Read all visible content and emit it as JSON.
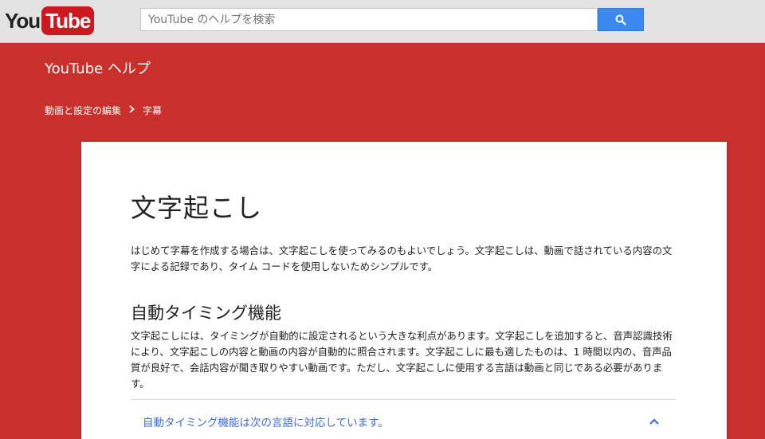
{
  "header": {
    "logo_you": "You",
    "logo_tube": "Tube",
    "search_placeholder": "YouTube のヘルプを検索",
    "search_icon": "search-icon"
  },
  "hero": {
    "help_title": "YouTube ヘルプ",
    "breadcrumb": [
      {
        "label": "動画と設定の編集"
      },
      {
        "label": "字幕"
      }
    ],
    "breadcrumb_separator_icon": "chevron-right-icon"
  },
  "article": {
    "title": "文字起こし",
    "intro": "はじめて字幕を作成する場合は、文字起こしを使ってみるのもよいでしょう。文字起こしは、動画で話されている内容の文字による記録であり、タイム コードを使用しないためシンプルです。",
    "section_heading": "自動タイミング機能",
    "section_body": "文字起こしには、タイミングが自動的に設定されるという大きな利点があります。文字起こしを追加すると、音声認識技術により、文字起こしの内容と動画の内容が自動的に照合されます。文字起こしに最も適したものは、1 時間以内の、音声品質が良好で、会話内容が聞き取りやすい動画です。ただし、文字起こしに使用する言語は動画と同じである必要があります。",
    "expander_label": "自動タイミング機能は次の言語に対応しています。",
    "expander_icon": "chevron-up-icon"
  },
  "colors": {
    "brand_red": "#c9302c",
    "search_blue": "#3b88f0",
    "link_blue": "#3c6ed8"
  }
}
